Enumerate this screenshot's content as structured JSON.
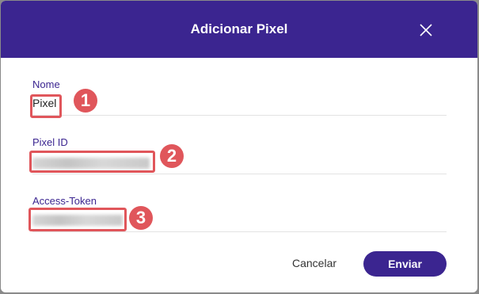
{
  "dialog": {
    "title": "Adicionar Pixel",
    "close_icon": "close-icon",
    "accent_color": "#3b2590"
  },
  "fields": {
    "name": {
      "label": "Nome",
      "value": "Pixel"
    },
    "pixel_id": {
      "label": "Pixel ID",
      "value_redacted": true
    },
    "access_token": {
      "label": "Access-Token",
      "value_redacted": true
    }
  },
  "annotations": {
    "badge_1": "1",
    "badge_2": "2",
    "badge_3": "3",
    "color": "#e0565b"
  },
  "actions": {
    "cancel_label": "Cancelar",
    "submit_label": "Enviar"
  }
}
